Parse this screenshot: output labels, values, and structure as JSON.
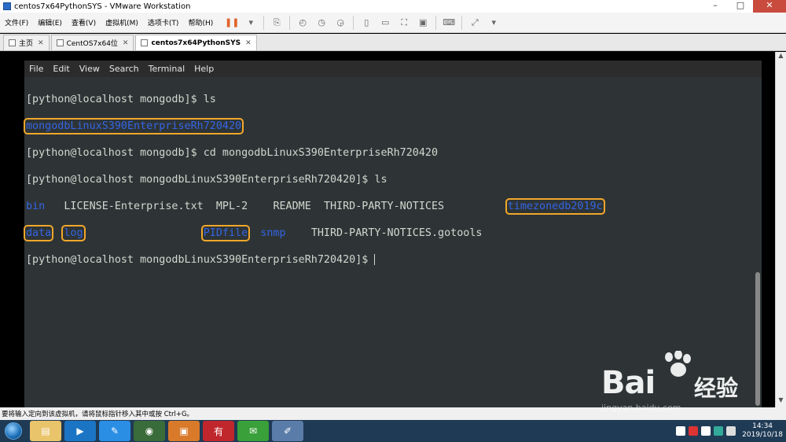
{
  "window": {
    "title": "centos7x64PythonSYS - VMware Workstation",
    "controls": [
      "–",
      "□",
      "✕"
    ]
  },
  "menubar": {
    "items": [
      "文件(F)",
      "编辑(E)",
      "查看(V)",
      "虚拟机(M)",
      "选项卡(T)",
      "帮助(H)"
    ]
  },
  "tabs": [
    {
      "label": "主页",
      "closable": true
    },
    {
      "label": "CentOS7x64位",
      "closable": true
    },
    {
      "label": "centos7x64PythonSYS",
      "closable": true,
      "active": true
    }
  ],
  "terminal": {
    "menu": [
      "File",
      "Edit",
      "View",
      "Search",
      "Terminal",
      "Help"
    ],
    "prompt1": "[python@localhost mongodb]$ ls",
    "dir_mongodb": "mongodbLinuxS390EnterpriseRh720420",
    "prompt2": "[python@localhost mongodb]$ cd mongodbLinuxS390EnterpriseRh720420",
    "prompt3": "[python@localhost mongodbLinuxS390EnterpriseRh720420]$ ls",
    "ls_row1": {
      "bin": "bin",
      "license": "LICENSE-Enterprise.txt",
      "mpl": "MPL-2",
      "readme": "README",
      "notices": "THIRD-PARTY-NOTICES",
      "timezone": "timezonedb2019c"
    },
    "ls_row2": {
      "data": "data",
      "log": "log",
      "pidfile": "PIDfile",
      "snmp": "snmp",
      "gotools": "THIRD-PARTY-NOTICES.gotools"
    },
    "prompt4": "[python@localhost mongodbLinuxS390EnterpriseRh720420]$ "
  },
  "statusbar": {
    "text": "要将输入定向到该虚拟机，请将鼠标指针移入其中或按 Ctrl+G。"
  },
  "taskbar": {
    "apps": [
      "explorer",
      "media",
      "notes",
      "chrome",
      "vmware",
      "youdao",
      "wechat",
      "paint"
    ],
    "clock_time": "14:34",
    "clock_date": "2019/10/18"
  },
  "watermark": {
    "brand": "Bai",
    "brand_suffix": "经验",
    "url": "jingyan.baidu.com"
  },
  "colors": {
    "accent": "#f2a72b",
    "dir_blue": "#3465e4",
    "term_bg": "#2e3436"
  }
}
